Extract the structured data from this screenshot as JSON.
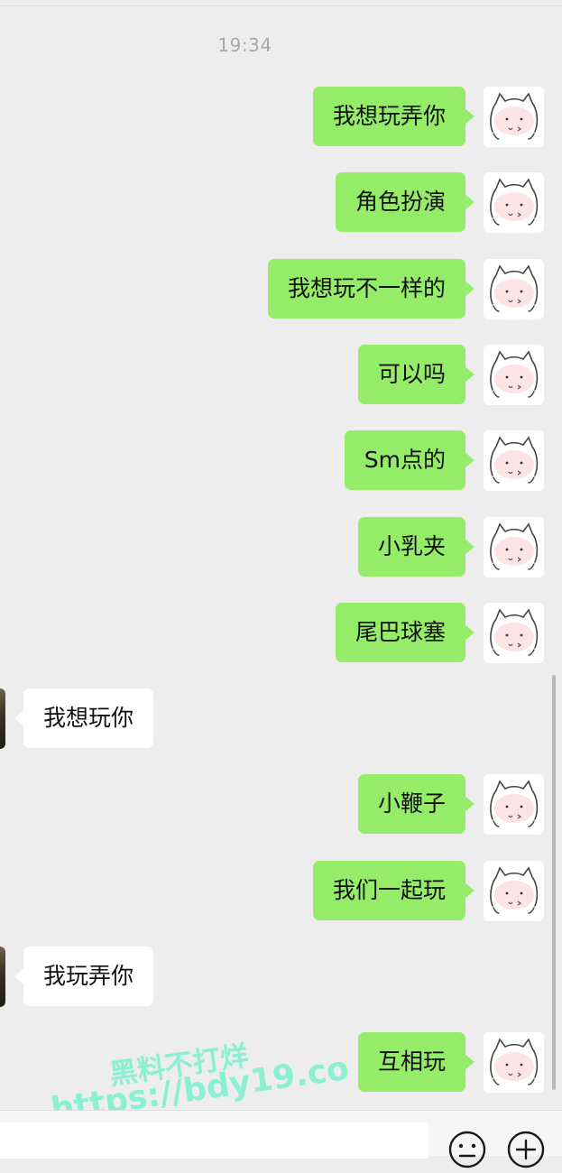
{
  "chat": {
    "timestamp": "19:34",
    "messages": [
      {
        "side": "out",
        "text": "我想玩弄你"
      },
      {
        "side": "out",
        "text": "角色扮演"
      },
      {
        "side": "out",
        "text": "我想玩不一样的"
      },
      {
        "side": "out",
        "text": "可以吗"
      },
      {
        "side": "out",
        "text": "Sm点的"
      },
      {
        "side": "out",
        "text": "小乳夹"
      },
      {
        "side": "out",
        "text": "尾巴球塞"
      },
      {
        "side": "in",
        "text": "我想玩你"
      },
      {
        "side": "out",
        "text": "小鞭子"
      },
      {
        "side": "out",
        "text": "我们一起玩"
      },
      {
        "side": "in",
        "text": "我玩弄你"
      },
      {
        "side": "out",
        "text": "互相玩"
      }
    ]
  },
  "watermark": {
    "line1": "黑料不打烊",
    "line2": "https://bdy19.co"
  },
  "input_bar": {
    "emoji_icon": "emoji-icon",
    "plus_icon": "plus-icon"
  },
  "colors": {
    "background": "#ededed",
    "outgoing_bubble": "#95ec69",
    "incoming_bubble": "#ffffff",
    "watermark": "#78f0cd"
  }
}
